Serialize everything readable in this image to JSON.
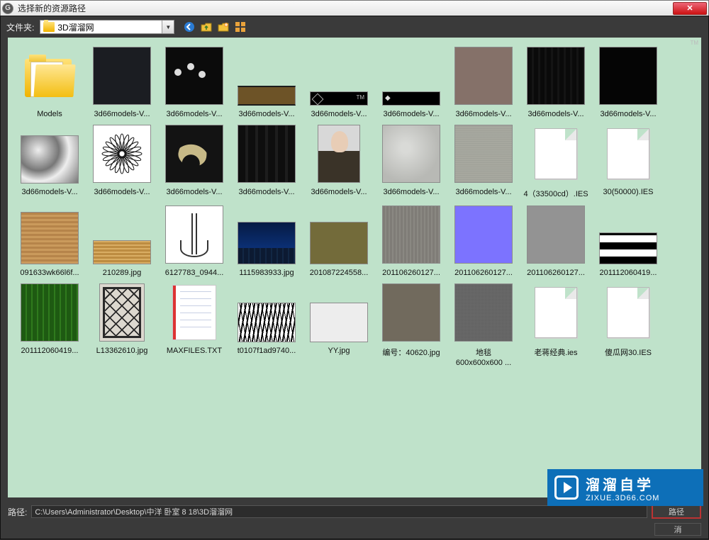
{
  "window": {
    "title": "选择新的资源路径",
    "close_glyph": "✕"
  },
  "toolbar": {
    "folder_label": "文件夹:",
    "folder_current": "3D溜溜网",
    "dropdown_glyph": "▼"
  },
  "items": [
    {
      "kind": "folder",
      "label": "Models"
    },
    {
      "kind": "img",
      "variant": "t-dark",
      "label": "3d66models-V..."
    },
    {
      "kind": "img",
      "variant": "t-dand",
      "label": "3d66models-V..."
    },
    {
      "kind": "img",
      "variant": "t-brown",
      "label": "3d66models-V..."
    },
    {
      "kind": "img",
      "variant": "t-stripb",
      "label": "3d66models-V..."
    },
    {
      "kind": "img",
      "variant": "t-stripb2",
      "label": "3d66models-V..."
    },
    {
      "kind": "img",
      "variant": "t-fabric",
      "label": "3d66models-V..."
    },
    {
      "kind": "img",
      "variant": "t-vstripe",
      "label": "3d66models-V..."
    },
    {
      "kind": "img",
      "variant": "t-black",
      "label": "3d66models-V..."
    },
    {
      "kind": "spacer"
    },
    {
      "kind": "img",
      "variant": "t-metal",
      "label": "3d66models-V..."
    },
    {
      "kind": "flower",
      "label": "3d66models-V..."
    },
    {
      "kind": "img",
      "variant": "t-ginkgo",
      "label": "3d66models-V..."
    },
    {
      "kind": "img",
      "variant": "t-vbars",
      "label": "3d66models-V..."
    },
    {
      "kind": "img",
      "variant": "t-person",
      "label": "3d66models-V..."
    },
    {
      "kind": "img",
      "variant": "t-grunge",
      "label": "3d66models-V..."
    },
    {
      "kind": "img",
      "variant": "t-grey",
      "label": "3d66models-V..."
    },
    {
      "kind": "file",
      "label": "4（33500cd）.IES"
    },
    {
      "kind": "file",
      "label": "30(50000).IES"
    },
    {
      "kind": "spacer"
    },
    {
      "kind": "img",
      "variant": "t-wood",
      "label": "091633wk66l6f..."
    },
    {
      "kind": "img",
      "variant": "t-wood2",
      "label": "210289.jpg"
    },
    {
      "kind": "img",
      "variant": "t-eiffel",
      "label": "6127783_0944..."
    },
    {
      "kind": "img",
      "variant": "t-city",
      "label": "1115983933.jpg"
    },
    {
      "kind": "img",
      "variant": "t-olive",
      "label": "201087224558..."
    },
    {
      "kind": "img",
      "variant": "t-greywv",
      "label": "201106260127..."
    },
    {
      "kind": "img",
      "variant": "t-purple",
      "label": "201106260127..."
    },
    {
      "kind": "img",
      "variant": "t-grey2",
      "label": "201106260127..."
    },
    {
      "kind": "img",
      "variant": "t-bw",
      "label": "201112060419..."
    },
    {
      "kind": "spacer"
    },
    {
      "kind": "img",
      "variant": "t-green",
      "label": "201112060419..."
    },
    {
      "kind": "img",
      "variant": "t-rug",
      "label": "L13362610.jpg"
    },
    {
      "kind": "txt",
      "label": "MAXFILES.TXT"
    },
    {
      "kind": "img",
      "variant": "t-trees",
      "label": "t0107f1ad9740..."
    },
    {
      "kind": "img",
      "variant": "t-white",
      "label": "YY.jpg"
    },
    {
      "kind": "img",
      "variant": "t-taupe",
      "label": "编号：40620.jpg"
    },
    {
      "kind": "img",
      "variant": "t-carpet",
      "label": "地毯",
      "label2": "600x600x600 ..."
    },
    {
      "kind": "file",
      "label": "老蒋经典.ies"
    },
    {
      "kind": "file",
      "label": "傻瓜网30.IES"
    },
    {
      "kind": "spacer"
    }
  ],
  "footer": {
    "path_label": "路径:",
    "path_value": "C:\\Users\\Administrator\\Desktop\\中洋 卧室 8 18\\3D溜溜网",
    "use_path": "路径",
    "cancel": "消"
  },
  "brand": {
    "big": "溜溜自学",
    "small": "ZIXUE.3D66.COM"
  }
}
